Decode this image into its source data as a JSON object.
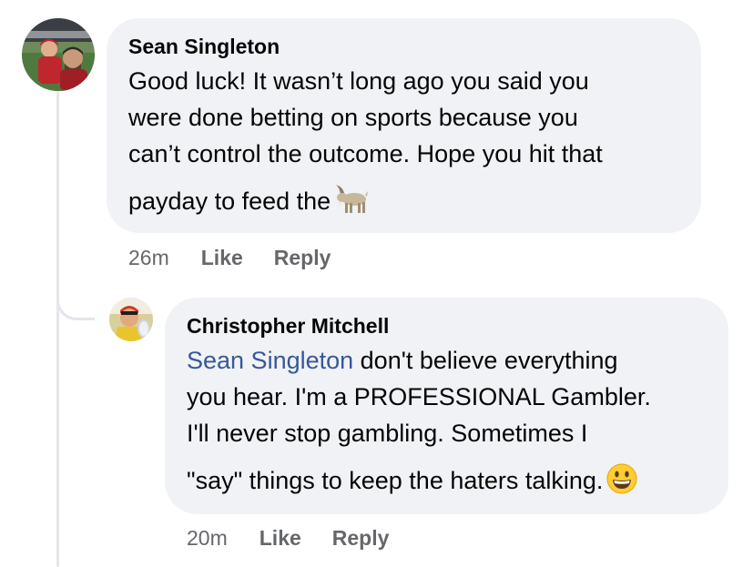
{
  "comments": [
    {
      "author": "Sean Singleton",
      "lines": [
        "Good luck! It wasn’t long ago you said you",
        "were done betting on sports because you",
        "can’t control the outcome. Hope you hit that",
        "payday to feed the"
      ],
      "trailing_emoji": "goat-emoji",
      "time": "26m",
      "like_label": "Like",
      "reply_label": "Reply"
    },
    {
      "author": "Christopher Mitchell",
      "mention": "Sean Singleton",
      "lines": [
        " don't believe everything",
        "you hear. I'm a PROFESSIONAL Gambler.",
        "I'll never stop gambling. Sometimes I",
        "\"say\" things to keep the haters talking."
      ],
      "trailing_emoji": "grinning-face-emoji",
      "time": "20m",
      "like_label": "Like",
      "reply_label": "Reply"
    }
  ]
}
